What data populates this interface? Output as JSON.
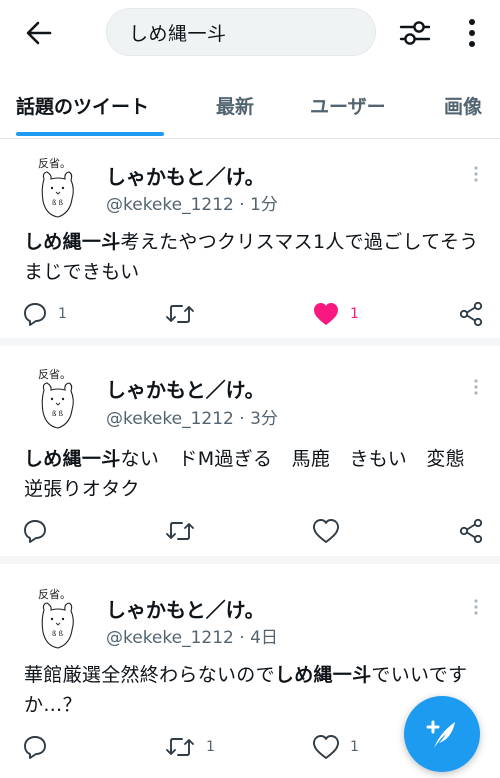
{
  "search": {
    "query": "しめ縄一斗"
  },
  "tabs": [
    {
      "label": "話題のツイート",
      "active": true
    },
    {
      "label": "最新"
    },
    {
      "label": "ユーザー"
    },
    {
      "label": "画像"
    }
  ],
  "tweets": [
    {
      "name": "しゃかもと／け。",
      "handle": "@kekeke_1212",
      "time_sep": " · ",
      "time": "1分",
      "text_bold": "しめ縄一斗",
      "text_rest": "考えたやつクリスマス1人で過ごしてそう　まじできもい",
      "reply_count": "1",
      "retweet_count": "",
      "like_count": "1",
      "liked": true
    },
    {
      "name": "しゃかもと／け。",
      "handle": "@kekeke_1212",
      "time_sep": " · ",
      "time": "3分",
      "text_bold": "しめ縄一斗",
      "text_rest": "ない　ドM過ぎる　馬鹿　きもい　変態　逆張りオタク",
      "reply_count": "",
      "retweet_count": "",
      "like_count": "",
      "liked": false
    },
    {
      "name": "しゃかもと／け。",
      "handle": "@kekeke_1212",
      "time_sep": " · ",
      "time": "4日",
      "text_pre": "華館厳選全然終わらないので",
      "text_bold": "しめ縄一斗",
      "text_rest": "でいいですか…？",
      "reply_count": "",
      "retweet_count": "1",
      "like_count": "1",
      "liked": false
    }
  ],
  "avatar_label": "反省。",
  "colors": {
    "accent": "#1d9bf0",
    "like": "#f91880",
    "muted": "#536471"
  },
  "icons": {
    "back": "arrow-left-icon",
    "filter": "sliders-icon",
    "more": "more-vertical-icon",
    "reply": "reply-icon",
    "retweet": "retweet-icon",
    "like": "heart-icon",
    "share": "share-icon",
    "compose": "compose-tweet-icon"
  }
}
